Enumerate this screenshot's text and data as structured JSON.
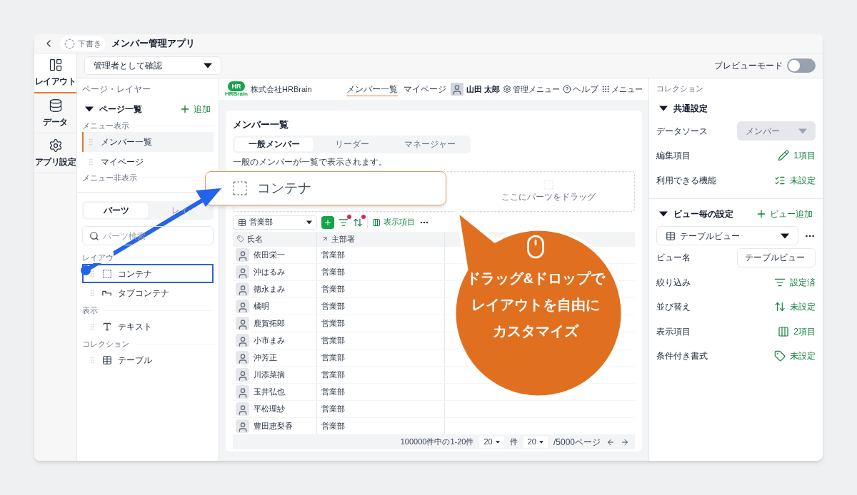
{
  "titlebar": {
    "status": "下書き",
    "title": "メンバー管理アプリ"
  },
  "toolbar": {
    "role_select": "管理者として確認",
    "preview_label": "プレビューモード",
    "preview_on": false
  },
  "rail": [
    {
      "label": "レイアウト",
      "selected": true
    },
    {
      "label": "データ",
      "selected": false
    },
    {
      "label": "アプリ設定",
      "selected": false
    }
  ],
  "left_panel": {
    "heading": "ページ・レイヤー",
    "pages_title": "ページ一覧",
    "add": "追加",
    "groups": [
      {
        "label": "メニュー表示",
        "items": [
          {
            "label": "メンバー一覧",
            "selected": true
          },
          {
            "label": "マイページ",
            "selected": false
          }
        ]
      },
      {
        "label": "メニュー非表示"
      }
    ],
    "tabs": [
      {
        "label": "パーツ",
        "selected": true
      },
      {
        "label": "レイ",
        "selected": false
      }
    ],
    "search_placeholder": "パーツ検索",
    "parts": [
      {
        "label": "レイアウ",
        "items": [
          {
            "label": "コンテナ",
            "selected": true,
            "kind": "container"
          },
          {
            "label": "タブコンテナ",
            "selected": false,
            "kind": "tabs"
          }
        ]
      },
      {
        "label": "表示",
        "items": [
          {
            "label": "テキスト",
            "selected": false,
            "kind": "text"
          }
        ]
      },
      {
        "label": "コレクション",
        "items": [
          {
            "label": "テーブル",
            "selected": false,
            "kind": "table"
          }
        ]
      }
    ]
  },
  "preview": {
    "logo": "HR",
    "logo_sub": "HRBrain",
    "company": "株式会社HRBrain",
    "nav": [
      {
        "label": "メンバー一覧",
        "selected": true
      },
      {
        "label": "マイページ",
        "selected": false
      }
    ],
    "user": "山田 太郎",
    "admin_menu": "管理メニュー",
    "help": "ヘルプ",
    "menu": "メニュー",
    "page_title": "メンバー一覧",
    "tabs": [
      {
        "label": "一般メンバー",
        "selected": true
      },
      {
        "label": "リーダー",
        "selected": false
      },
      {
        "label": "マネージャー",
        "selected": false
      }
    ],
    "description": "一般のメンバーが一覧で表示されます。",
    "drop_hint": "ここにパーツをドラッグ",
    "view_select": "営業部",
    "columns_button": "表示項目",
    "filter_active": true,
    "sort_active": true,
    "columns": [
      "氏名",
      "主部署"
    ],
    "rows": [
      {
        "name": "依田栄一",
        "dept": "営業部"
      },
      {
        "name": "沖はるみ",
        "dept": "営業部"
      },
      {
        "name": "徳永まみ",
        "dept": "営業部"
      },
      {
        "name": "橘明",
        "dept": "営業部"
      },
      {
        "name": "鹿賀拓郎",
        "dept": "営業部"
      },
      {
        "name": "小市まみ",
        "dept": "営業部"
      },
      {
        "name": "沖芳正",
        "dept": "営業部"
      },
      {
        "name": "川添菜摘",
        "dept": "営業部"
      },
      {
        "name": "玉井弘也",
        "dept": "営業部"
      },
      {
        "name": "平松理紗",
        "dept": "営業部"
      },
      {
        "name": "豊田恵梨香",
        "dept": "営業部"
      }
    ],
    "pager": {
      "range": "100000件中の1-20件",
      "per_page": "20",
      "per_page_unit": "件",
      "page": "20",
      "page_total": "/5000ページ"
    }
  },
  "drag_card": {
    "label": "コンテナ"
  },
  "callout": {
    "lines": [
      "ドラッグ&ドロップで",
      "レイアウトを自由に",
      "カスタマイズ"
    ]
  },
  "right_panel": {
    "heading": "コレクション",
    "common": {
      "title": "共通設定",
      "rows": [
        {
          "kind": "select",
          "label": "データソース",
          "value": "メンバー",
          "disabled": true
        },
        {
          "kind": "link",
          "label": "編集項目",
          "value": "1項目"
        },
        {
          "kind": "link",
          "label": "利用できる機能",
          "value": "未設定"
        }
      ]
    },
    "views": {
      "title": "ビュー毎の設定",
      "add": "ビュー追加",
      "view_select": "テーブルビュー",
      "rows": [
        {
          "kind": "input",
          "label": "ビュー名",
          "value": "テーブルビュー"
        },
        {
          "kind": "link",
          "label": "絞り込み",
          "value": "設定済"
        },
        {
          "kind": "link",
          "label": "並び替え",
          "value": "未設定"
        },
        {
          "kind": "link",
          "label": "表示項目",
          "value": "2項目"
        },
        {
          "kind": "link",
          "label": "条件付き書式",
          "value": "未設定"
        }
      ]
    }
  }
}
